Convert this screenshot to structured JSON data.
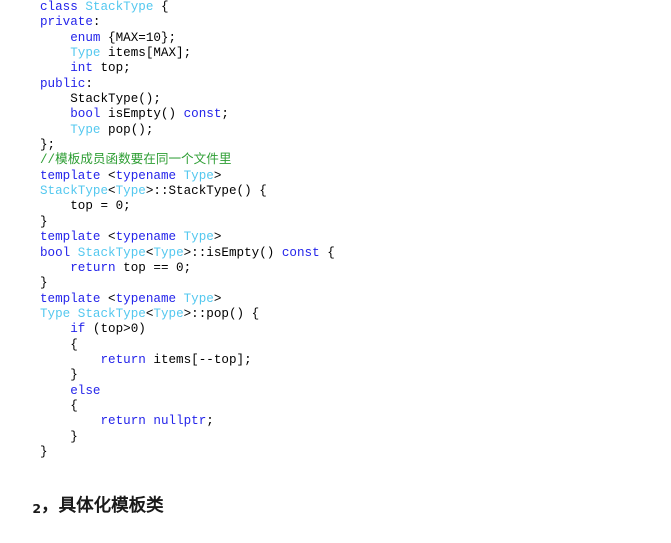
{
  "document": {
    "background_color": "#ffffff",
    "code": {
      "language": "cpp",
      "colors": {
        "keyword": "#2424ea",
        "type": "#54c8ef",
        "comment": "#2e9e34",
        "plain": "#000000"
      },
      "lines": [
        {
          "indent": 0,
          "tokens": [
            {
              "t": "class ",
              "c": "keyword"
            },
            {
              "t": "StackType",
              "c": "type"
            },
            {
              "t": " {",
              "c": "plain"
            }
          ]
        },
        {
          "indent": 0,
          "tokens": [
            {
              "t": "private",
              "c": "keyword"
            },
            {
              "t": ":",
              "c": "plain"
            }
          ]
        },
        {
          "indent": 1,
          "tokens": [
            {
              "t": "enum",
              "c": "keyword"
            },
            {
              "t": " {MAX=10};",
              "c": "plain"
            }
          ]
        },
        {
          "indent": 1,
          "tokens": [
            {
              "t": "Type",
              "c": "type"
            },
            {
              "t": " items[MAX];",
              "c": "plain"
            }
          ]
        },
        {
          "indent": 1,
          "tokens": [
            {
              "t": "int",
              "c": "keyword"
            },
            {
              "t": " top;",
              "c": "plain"
            }
          ]
        },
        {
          "indent": 0,
          "tokens": [
            {
              "t": "public",
              "c": "keyword"
            },
            {
              "t": ":",
              "c": "plain"
            }
          ]
        },
        {
          "indent": 1,
          "tokens": [
            {
              "t": "StackType();",
              "c": "plain"
            }
          ]
        },
        {
          "indent": 1,
          "tokens": [
            {
              "t": "bool",
              "c": "keyword"
            },
            {
              "t": " isEmpty() ",
              "c": "plain"
            },
            {
              "t": "const",
              "c": "keyword"
            },
            {
              "t": ";",
              "c": "plain"
            }
          ]
        },
        {
          "indent": 1,
          "tokens": [
            {
              "t": "Type",
              "c": "type"
            },
            {
              "t": " pop();",
              "c": "plain"
            }
          ]
        },
        {
          "indent": 0,
          "tokens": [
            {
              "t": "};",
              "c": "plain"
            }
          ]
        },
        {
          "indent": 0,
          "tokens": [
            {
              "t": "//模板成员函数要在同一个文件里",
              "c": "comment"
            }
          ]
        },
        {
          "indent": 0,
          "tokens": [
            {
              "t": "template",
              "c": "keyword"
            },
            {
              "t": " <",
              "c": "plain"
            },
            {
              "t": "typename",
              "c": "keyword"
            },
            {
              "t": " ",
              "c": "plain"
            },
            {
              "t": "Type",
              "c": "type"
            },
            {
              "t": ">",
              "c": "plain"
            }
          ]
        },
        {
          "indent": 0,
          "tokens": [
            {
              "t": "StackType",
              "c": "type"
            },
            {
              "t": "<",
              "c": "plain"
            },
            {
              "t": "Type",
              "c": "type"
            },
            {
              "t": ">::StackType() {",
              "c": "plain"
            }
          ]
        },
        {
          "indent": 1,
          "tokens": [
            {
              "t": "top = 0;",
              "c": "plain"
            }
          ]
        },
        {
          "indent": 0,
          "tokens": [
            {
              "t": "}",
              "c": "plain"
            }
          ]
        },
        {
          "indent": 0,
          "tokens": [
            {
              "t": "template",
              "c": "keyword"
            },
            {
              "t": " <",
              "c": "plain"
            },
            {
              "t": "typename",
              "c": "keyword"
            },
            {
              "t": " ",
              "c": "plain"
            },
            {
              "t": "Type",
              "c": "type"
            },
            {
              "t": ">",
              "c": "plain"
            }
          ]
        },
        {
          "indent": 0,
          "tokens": [
            {
              "t": "bool",
              "c": "keyword"
            },
            {
              "t": " ",
              "c": "plain"
            },
            {
              "t": "StackType",
              "c": "type"
            },
            {
              "t": "<",
              "c": "plain"
            },
            {
              "t": "Type",
              "c": "type"
            },
            {
              "t": ">::isEmpty() ",
              "c": "plain"
            },
            {
              "t": "const",
              "c": "keyword"
            },
            {
              "t": " {",
              "c": "plain"
            }
          ]
        },
        {
          "indent": 1,
          "tokens": [
            {
              "t": "return",
              "c": "keyword"
            },
            {
              "t": " top == 0;",
              "c": "plain"
            }
          ]
        },
        {
          "indent": 0,
          "tokens": [
            {
              "t": "}",
              "c": "plain"
            }
          ]
        },
        {
          "indent": 0,
          "tokens": [
            {
              "t": "template",
              "c": "keyword"
            },
            {
              "t": " <",
              "c": "plain"
            },
            {
              "t": "typename",
              "c": "keyword"
            },
            {
              "t": " ",
              "c": "plain"
            },
            {
              "t": "Type",
              "c": "type"
            },
            {
              "t": ">",
              "c": "plain"
            }
          ]
        },
        {
          "indent": 0,
          "tokens": [
            {
              "t": "Type",
              "c": "type"
            },
            {
              "t": " ",
              "c": "plain"
            },
            {
              "t": "StackType",
              "c": "type"
            },
            {
              "t": "<",
              "c": "plain"
            },
            {
              "t": "Type",
              "c": "type"
            },
            {
              "t": ">::pop() {",
              "c": "plain"
            }
          ]
        },
        {
          "indent": 1,
          "tokens": [
            {
              "t": "if",
              "c": "keyword"
            },
            {
              "t": " (top>0)",
              "c": "plain"
            }
          ]
        },
        {
          "indent": 1,
          "tokens": [
            {
              "t": "{",
              "c": "plain"
            }
          ]
        },
        {
          "indent": 2,
          "tokens": [
            {
              "t": "return",
              "c": "keyword"
            },
            {
              "t": " items[--top];",
              "c": "plain"
            }
          ]
        },
        {
          "indent": 1,
          "tokens": [
            {
              "t": "}",
              "c": "plain"
            }
          ]
        },
        {
          "indent": 1,
          "tokens": [
            {
              "t": "else",
              "c": "keyword"
            }
          ]
        },
        {
          "indent": 1,
          "tokens": [
            {
              "t": "{",
              "c": "plain"
            }
          ]
        },
        {
          "indent": 2,
          "tokens": [
            {
              "t": "return",
              "c": "keyword"
            },
            {
              "t": " ",
              "c": "plain"
            },
            {
              "t": "nullptr",
              "c": "keyword"
            },
            {
              "t": ";",
              "c": "plain"
            }
          ]
        },
        {
          "indent": 1,
          "tokens": [
            {
              "t": "}",
              "c": "plain"
            }
          ]
        },
        {
          "indent": 0,
          "tokens": [
            {
              "t": "}",
              "c": "plain"
            }
          ]
        }
      ]
    },
    "heading": {
      "number": "2",
      "separator": "，",
      "text": "具体化模板类"
    }
  }
}
